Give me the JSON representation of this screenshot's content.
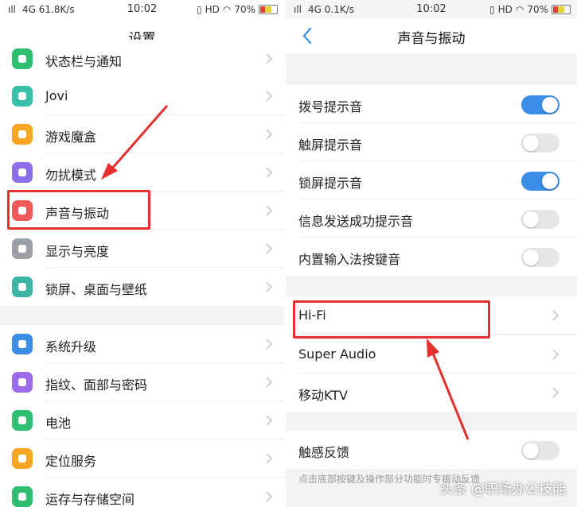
{
  "left": {
    "status": {
      "signal": "ıll",
      "network": "4G 61.8K/s",
      "time": "10:02",
      "hd": "HD",
      "battery": "70%"
    },
    "title": "设置",
    "items": [
      {
        "label": "状态栏与通知",
        "color": "#2fbf71",
        "icon": "status-icon"
      },
      {
        "label": "Jovi",
        "color": "#39c0a8",
        "icon": "jovi-icon"
      },
      {
        "label": "游戏魔盒",
        "color": "#f5a623",
        "icon": "gamepad-icon"
      },
      {
        "label": "勿扰模式",
        "color": "#8b6fe8",
        "icon": "moon-icon"
      },
      {
        "label": "声音与振动",
        "color": "#f05a5a",
        "icon": "speaker-icon"
      },
      {
        "label": "显示与亮度",
        "color": "#9aa0a6",
        "icon": "sun-icon"
      },
      {
        "label": "锁屏、桌面与壁纸",
        "color": "#3cb5a2",
        "icon": "palette-icon"
      },
      {
        "label": "系统升级",
        "color": "#3a8ee6",
        "icon": "upgrade-icon"
      },
      {
        "label": "指纹、面部与密码",
        "color": "#9b6bea",
        "icon": "fingerprint-icon"
      },
      {
        "label": "电池",
        "color": "#2fbf71",
        "icon": "battery-icon"
      },
      {
        "label": "定位服务",
        "color": "#f5a623",
        "icon": "location-icon"
      },
      {
        "label": "运存与存储空间",
        "color": "#2fbf71",
        "icon": "storage-icon"
      }
    ]
  },
  "right": {
    "status": {
      "signal": "ıll",
      "network": "4G 0.1K/s",
      "time": "10:02",
      "hd": "HD",
      "battery": "70%"
    },
    "title": "声音与振动",
    "toggles": [
      {
        "label": "拨号提示音",
        "on": true
      },
      {
        "label": "触屏提示音",
        "on": false
      },
      {
        "label": "锁屏提示音",
        "on": true
      },
      {
        "label": "信息发送成功提示音",
        "on": false
      },
      {
        "label": "内置输入法按键音",
        "on": false
      }
    ],
    "links": [
      {
        "label": "Hi-Fi"
      },
      {
        "label": "Super Audio"
      },
      {
        "label": "移动KTV"
      }
    ],
    "haptic": {
      "label": "触感反馈",
      "on": false
    },
    "footnote": "点击底部按键及操作部分功能时专振动反馈"
  },
  "watermark": "头条 @职场办公技能",
  "colors": {
    "accent": "#3a8ee6",
    "highlight": "#e53030"
  }
}
